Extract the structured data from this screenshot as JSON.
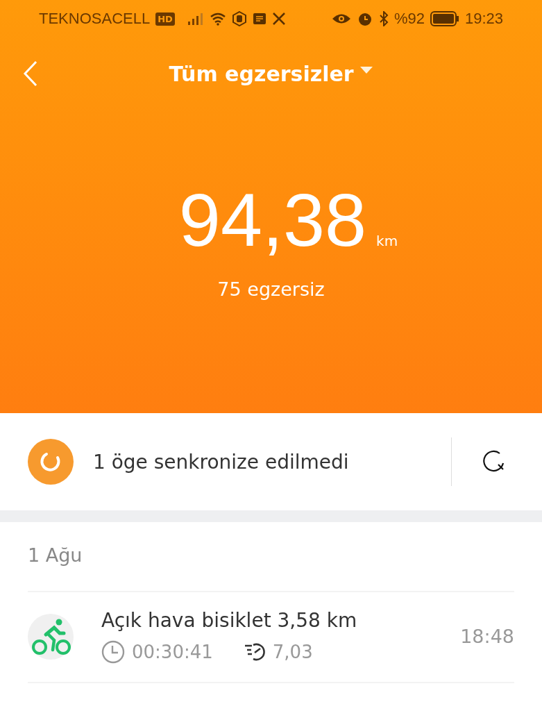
{
  "status_bar": {
    "carrier": "TEKNOSACELL",
    "network_badge": "HD",
    "battery_percent": "%92",
    "time": "19:23"
  },
  "header": {
    "title": "Tüm egzersizler",
    "total_distance": "94,38",
    "unit": "km",
    "workout_count": "75 egzersiz"
  },
  "sync_banner": {
    "message": "1 öge senkronize edilmedi"
  },
  "groups": [
    {
      "date": "1 Ağu",
      "workouts": [
        {
          "kind": "cycling",
          "title": "Açık hava bisiklet 3,58 km",
          "duration": "00:30:41",
          "pace": "7,03",
          "time": "18:48"
        }
      ]
    }
  ]
}
